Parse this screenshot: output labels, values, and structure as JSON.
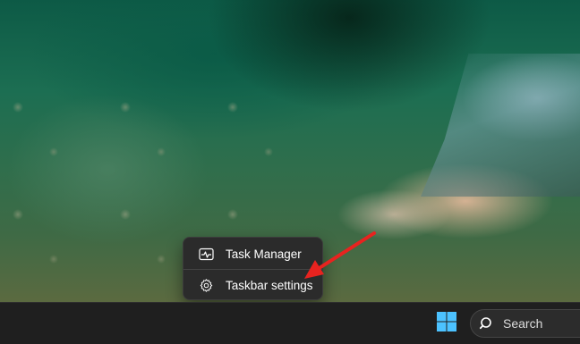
{
  "context_menu": {
    "items": [
      {
        "label": "Task Manager",
        "icon": "task-manager-icon"
      },
      {
        "label": "Taskbar settings",
        "icon": "gear-icon"
      }
    ]
  },
  "annotation": {
    "color": "#e8231f",
    "points_to": "Taskbar settings"
  },
  "taskbar": {
    "start_icon": "windows-logo-icon",
    "search": {
      "label": "Search",
      "icon": "search-icon"
    }
  },
  "colors": {
    "menu_background": "#2b2b2b",
    "taskbar_background": "#1f1f1f",
    "windows_logo": "#4cc2ff"
  }
}
